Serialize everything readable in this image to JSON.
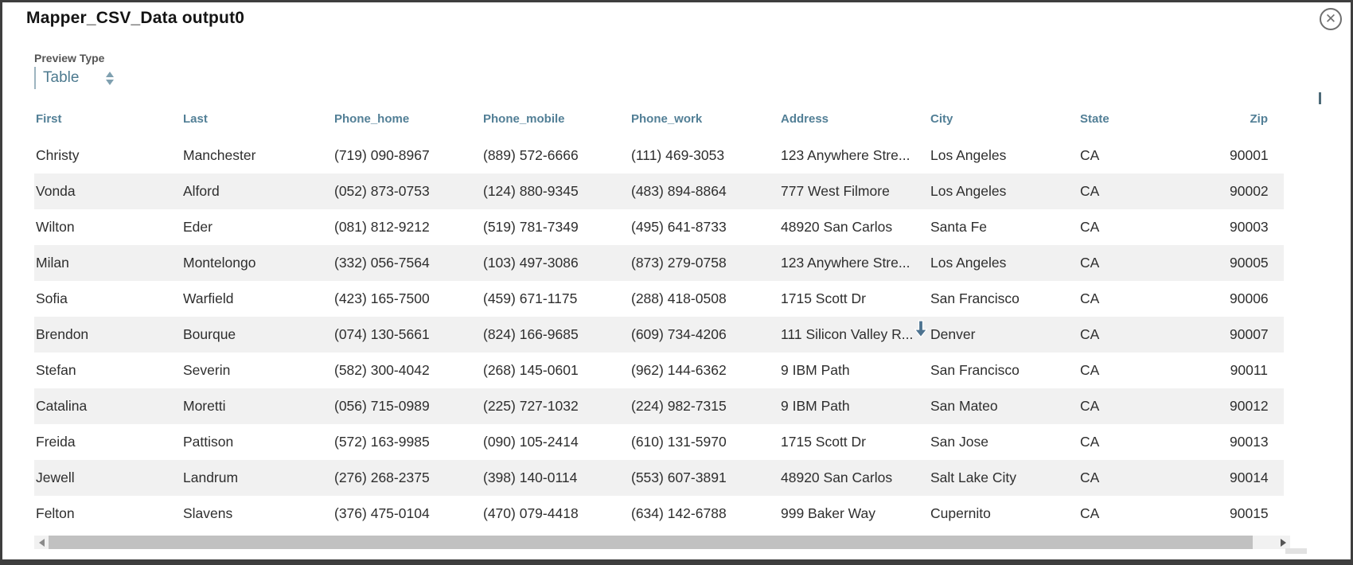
{
  "dialog": {
    "title": "Mapper_CSV_Data output0"
  },
  "preview": {
    "label": "Preview Type",
    "selected": "Table"
  },
  "icons": {
    "close": "✕",
    "select_spinner": "up-down-arrows",
    "cursor": "down-arrow",
    "scroll_left": "left-triangle",
    "scroll_right": "right-triangle"
  },
  "colors": {
    "accent": "#527f96",
    "body_text": "#2e2e2e",
    "row_stripe": "#f1f1f1",
    "frame": "#3e3e3e",
    "select_text": "#4d7a8f"
  },
  "table": {
    "columns": [
      "First",
      "Last",
      "Phone_home",
      "Phone_mobile",
      "Phone_work",
      "Address",
      "City",
      "State",
      "Zip"
    ],
    "rows": [
      [
        "Christy",
        "Manchester",
        "(719) 090-8967",
        "(889) 572-6666",
        "(111) 469-3053",
        "123 Anywhere Stre...",
        "Los Angeles",
        "CA",
        "90001"
      ],
      [
        "Vonda",
        "Alford",
        "(052) 873-0753",
        "(124) 880-9345",
        "(483) 894-8864",
        "777 West Filmore",
        "Los Angeles",
        "CA",
        "90002"
      ],
      [
        "Wilton",
        "Eder",
        "(081) 812-9212",
        "(519) 781-7349",
        "(495) 641-8733",
        "48920 San Carlos",
        "Santa Fe",
        "CA",
        "90003"
      ],
      [
        "Milan",
        "Montelongo",
        "(332) 056-7564",
        "(103) 497-3086",
        "(873) 279-0758",
        "123 Anywhere Stre...",
        "Los Angeles",
        "CA",
        "90005"
      ],
      [
        "Sofia",
        "Warfield",
        "(423) 165-7500",
        "(459) 671-1175",
        "(288) 418-0508",
        "1715 Scott Dr",
        "San Francisco",
        "CA",
        "90006"
      ],
      [
        "Brendon",
        "Bourque",
        "(074) 130-5661",
        "(824) 166-9685",
        "(609) 734-4206",
        "111 Silicon Valley R...",
        "Denver",
        "CA",
        "90007"
      ],
      [
        "Stefan",
        "Severin",
        "(582) 300-4042",
        "(268) 145-0601",
        "(962) 144-6362",
        "9 IBM Path",
        "San Francisco",
        "CA",
        "90011"
      ],
      [
        "Catalina",
        "Moretti",
        "(056) 715-0989",
        "(225) 727-1032",
        "(224) 982-7315",
        "9 IBM Path",
        "San Mateo",
        "CA",
        "90012"
      ],
      [
        "Freida",
        "Pattison",
        "(572) 163-9985",
        "(090) 105-2414",
        "(610) 131-5970",
        "1715 Scott Dr",
        "San Jose",
        "CA",
        "90013"
      ],
      [
        "Jewell",
        "Landrum",
        "(276) 268-2375",
        "(398) 140-0114",
        "(553) 607-3891",
        "48920 San Carlos",
        "Salt Lake City",
        "CA",
        "90014"
      ],
      [
        "Felton",
        "Slavens",
        "(376) 475-0104",
        "(470) 079-4418",
        "(634) 142-6788",
        "999 Baker Way",
        "Cupernito",
        "CA",
        "90015"
      ]
    ]
  }
}
